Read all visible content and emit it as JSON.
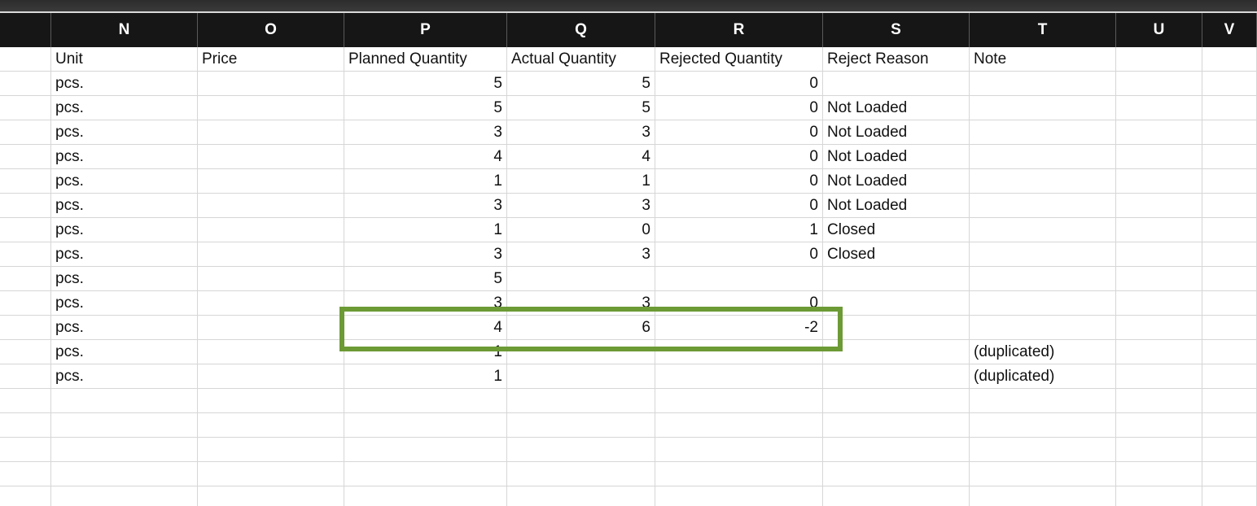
{
  "columns": [
    "N",
    "O",
    "P",
    "Q",
    "R",
    "S",
    "T",
    "U",
    "V"
  ],
  "table": {
    "headers": [
      "Unit",
      "Price",
      "Planned Quantity",
      "Actual Quantity",
      "Rejected Quantity",
      "Reject Reason",
      "Note",
      "",
      ""
    ],
    "rows": [
      [
        "pcs.",
        "",
        "5",
        "5",
        "0",
        "",
        "",
        "",
        ""
      ],
      [
        "pcs.",
        "",
        "5",
        "5",
        "0",
        "Not Loaded",
        "",
        "",
        ""
      ],
      [
        "pcs.",
        "",
        "3",
        "3",
        "0",
        "Not Loaded",
        "",
        "",
        ""
      ],
      [
        "pcs.",
        "",
        "4",
        "4",
        "0",
        "Not Loaded",
        "",
        "",
        ""
      ],
      [
        "pcs.",
        "",
        "1",
        "1",
        "0",
        "Not Loaded",
        "",
        "",
        ""
      ],
      [
        "pcs.",
        "",
        "3",
        "3",
        "0",
        "Not Loaded",
        "",
        "",
        ""
      ],
      [
        "pcs.",
        "",
        "1",
        "0",
        "1",
        "Closed",
        "",
        "",
        ""
      ],
      [
        "pcs.",
        "",
        "3",
        "3",
        "0",
        "Closed",
        "",
        "",
        ""
      ],
      [
        "pcs.",
        "",
        "5",
        "",
        "",
        "",
        "",
        "",
        ""
      ],
      [
        "pcs.",
        "",
        "3",
        "3",
        "0",
        "",
        "",
        "",
        ""
      ],
      [
        "pcs.",
        "",
        "4",
        "6",
        "-2",
        "",
        "",
        "",
        ""
      ],
      [
        "pcs.",
        "",
        "1",
        "",
        "",
        "",
        "(duplicated)",
        "",
        ""
      ],
      [
        "pcs.",
        "",
        "1",
        "",
        "",
        "",
        "(duplicated)",
        "",
        ""
      ],
      [
        "",
        "",
        "",
        "",
        "",
        "",
        "",
        "",
        ""
      ],
      [
        "",
        "",
        "",
        "",
        "",
        "",
        "",
        "",
        ""
      ],
      [
        "",
        "",
        "",
        "",
        "",
        "",
        "",
        "",
        ""
      ],
      [
        "",
        "",
        "",
        "",
        "",
        "",
        "",
        "",
        ""
      ],
      [
        "",
        "",
        "",
        "",
        "",
        "",
        "",
        "",
        ""
      ]
    ]
  },
  "highlight": {
    "color": "#6c9a35"
  }
}
